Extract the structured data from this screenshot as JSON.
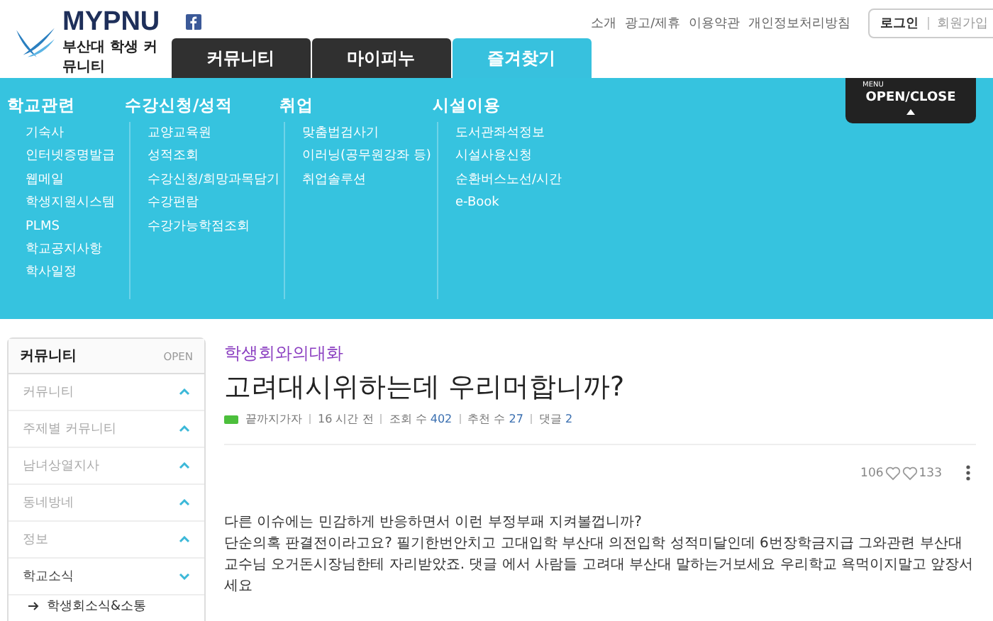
{
  "logo": {
    "name": "MYPNU",
    "tagline": "부산대 학생 커뮤니티"
  },
  "top_links": [
    "소개",
    "광고/제휴",
    "이용약관",
    "개인정보처리방침"
  ],
  "auth": [
    "로그인",
    "회원가입"
  ],
  "tabs": [
    {
      "label": "커뮤니티",
      "selected": false
    },
    {
      "label": "마이피누",
      "selected": false
    },
    {
      "label": "즐겨찾기",
      "selected": true
    }
  ],
  "menu_toggle": {
    "small": "MENU",
    "label": "OPEN/CLOSE"
  },
  "menu": [
    {
      "heading": "학교관련",
      "items": [
        "기숙사",
        "인터넷증명발급",
        "웹메일",
        "학생지원시스템",
        "PLMS",
        "학교공지사항",
        "학사일정"
      ]
    },
    {
      "heading": "수강신청/성적",
      "items": [
        "교양교육원",
        "성적조회",
        "수강신청/희망과목담기",
        "수강편람",
        "수강가능학점조회"
      ]
    },
    {
      "heading": "취업",
      "items": [
        "맞춤법검사기",
        "이러닝(공무원강좌 등)",
        "취업솔루션"
      ]
    },
    {
      "heading": "시설이용",
      "items": [
        "도서관좌석정보",
        "시설사용신청",
        "순환버스노선/시간",
        "e-Book"
      ]
    }
  ],
  "sidebar": {
    "title": "커뮤니티",
    "action": "OPEN",
    "items": [
      {
        "label": "커뮤니티",
        "expanded": false
      },
      {
        "label": "주제별 커뮤니티",
        "expanded": false
      },
      {
        "label": "남녀상열지사",
        "expanded": false
      },
      {
        "label": "동네방네",
        "expanded": false
      },
      {
        "label": "정보",
        "expanded": false
      },
      {
        "label": "학교소식",
        "expanded": true,
        "children": [
          "학생회소식&소통"
        ]
      }
    ]
  },
  "post": {
    "category": "학생회와의대화",
    "title": "고려대시위하는데 우리머합니까?",
    "author": "끝까지가자",
    "time": "16 시간 전",
    "views_label": "조회 수",
    "views": "402",
    "likes_label": "추천 수",
    "likes": "27",
    "comments_label": "댓글",
    "comments": "2",
    "upvotes": "106",
    "downvotes": "133",
    "body": [
      "다른 이슈에는 민감하게 반응하면서 이런 부정부패 지켜볼껍니까?",
      "단순의혹 판결전이라고요?  필기한번안치고 고대입학 부산대 의전입학 성적미달인데 6번장학금지급 그와관련 부산대교수님  오거돈시장님한테 자리받았죠. 댓글 에서 사람들 고려대 부산대 말하는거보세요 우리학교 욕먹이지말고 앞장서세요"
    ]
  }
}
